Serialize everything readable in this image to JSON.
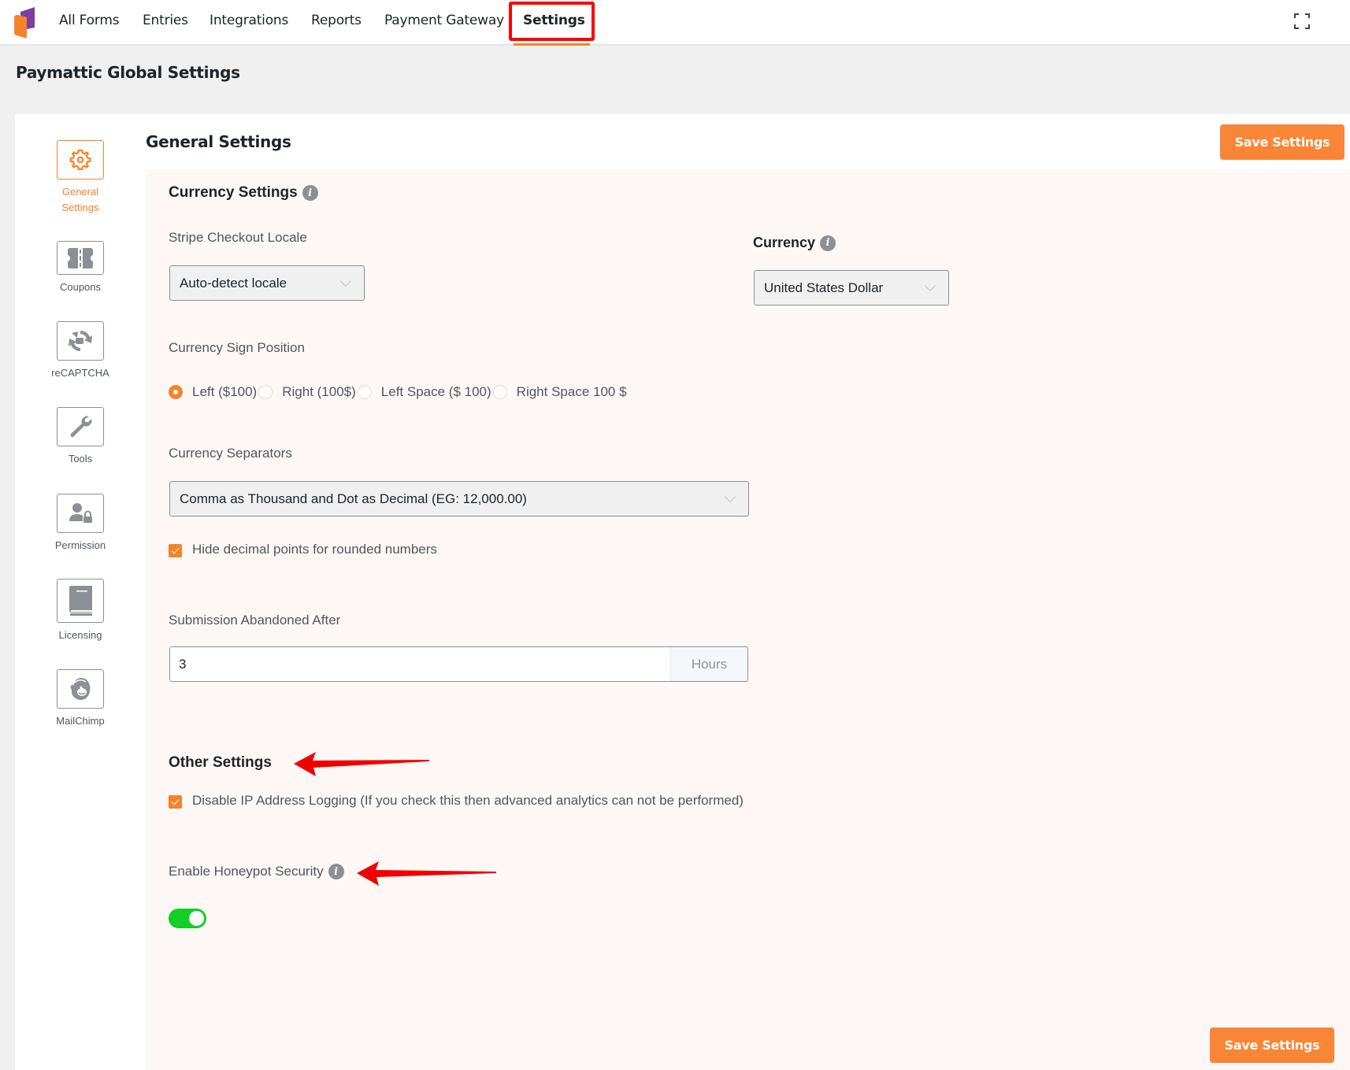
{
  "topnav": {
    "items": [
      {
        "label": "All Forms"
      },
      {
        "label": "Entries"
      },
      {
        "label": "Integrations"
      },
      {
        "label": "Reports"
      },
      {
        "label": "Payment Gateway"
      },
      {
        "label": "Settings",
        "active": true
      }
    ],
    "fullscreen_icon": "fullscreen-icon"
  },
  "page": {
    "title": "Paymattic Global Settings"
  },
  "sidebar": {
    "items": [
      {
        "label_line1": "General",
        "label_line2": "Settings",
        "icon": "gear-icon",
        "active": true
      },
      {
        "label": "Coupons",
        "icon": "coupon-icon"
      },
      {
        "label": "reCAPTCHA",
        "icon": "recaptcha-icon"
      },
      {
        "label": "Tools",
        "icon": "wrench-icon"
      },
      {
        "label": "Permission",
        "icon": "user-lock-icon"
      },
      {
        "label": "Licensing",
        "icon": "book-icon"
      },
      {
        "label": "MailChimp",
        "icon": "mailchimp-icon"
      }
    ]
  },
  "content": {
    "heading": "General Settings",
    "save_label": "Save Settings",
    "currency_settings": {
      "title": "Currency Settings",
      "stripe_locale": {
        "label": "Stripe Checkout Locale",
        "value": "Auto-detect locale"
      },
      "currency": {
        "label": "Currency",
        "value": "United States Dollar"
      },
      "sign_position": {
        "label": "Currency Sign Position",
        "options": [
          {
            "label": "Left ($100)",
            "checked": true
          },
          {
            "label": "Right (100$)",
            "checked": false
          },
          {
            "label": "Left Space ($ 100)",
            "checked": false
          },
          {
            "label": "Right Space 100 $",
            "checked": false
          }
        ]
      },
      "separators": {
        "label": "Currency Separators",
        "value": "Comma as Thousand and Dot as Decimal (EG: 12,000.00)"
      },
      "hide_decimal": {
        "label": "Hide decimal points for rounded numbers",
        "checked": true
      },
      "abandoned": {
        "label": "Submission Abandoned After",
        "value": "3",
        "unit": "Hours"
      }
    },
    "other_settings": {
      "title": "Other Settings",
      "disable_ip": {
        "label": "Disable IP Address Logging (If you check this then advanced analytics can not be performed)",
        "checked": true
      },
      "honeypot": {
        "label": "Enable Honeypot Security",
        "enabled": true
      }
    }
  },
  "colors": {
    "accent": "#f5832a",
    "button": "#f98537",
    "toggle_on": "#13ce24",
    "annotation": "#ff0000"
  }
}
